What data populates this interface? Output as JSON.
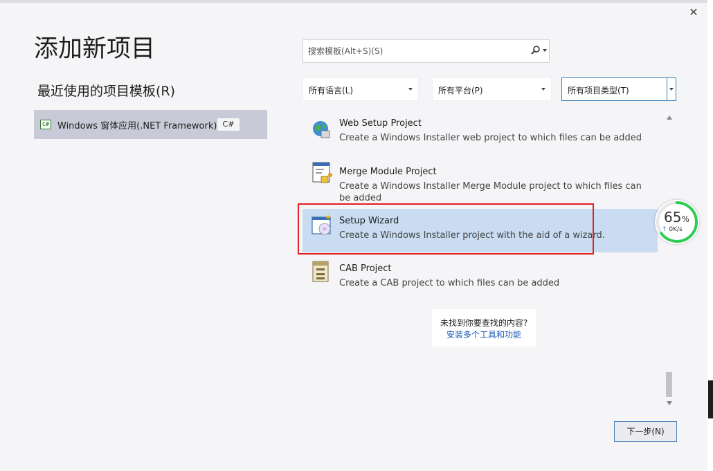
{
  "dialog": {
    "title": "添加新项目",
    "close_glyph": "✕"
  },
  "recent": {
    "heading": "最近使用的项目模板(R)",
    "items": [
      {
        "label": "Windows 窗体应用(.NET Framework)",
        "language": "C#",
        "icon": "csharp-project-icon"
      }
    ]
  },
  "search": {
    "placeholder": "搜索模板(Alt+S)(S)",
    "value": ""
  },
  "filters": {
    "language": "所有语言(L)",
    "platform": "所有平台(P)",
    "project_type": "所有项目类型(T)"
  },
  "templates": [
    {
      "name": "Web Setup Project",
      "description": "Create a Windows Installer web project to which files can be added",
      "icon": "web-setup-icon",
      "selected": false
    },
    {
      "name": "Merge Module Project",
      "description": "Create a Windows Installer Merge Module project to which files can be added",
      "icon": "merge-module-icon",
      "selected": false
    },
    {
      "name": "Setup Wizard",
      "description": "Create a Windows Installer project with the aid of a wizard.",
      "icon": "setup-wizard-icon",
      "selected": true
    },
    {
      "name": "CAB Project",
      "description": "Create a CAB project to which files can be added",
      "icon": "cab-project-icon",
      "selected": false
    }
  ],
  "not_found": {
    "question": "未找到你要查找的内容?",
    "link": "安装多个工具和功能"
  },
  "footer": {
    "next_label": "下一步(N)"
  },
  "speed_widget": {
    "percent": "65",
    "percent_unit": "%",
    "rate": "0K/s",
    "percent_value": 0.65
  },
  "colors": {
    "selected_bg": "#c9dcf2",
    "highlight_border": "#e02020",
    "link": "#1a5bb5",
    "gauge": "#2ecc55"
  }
}
